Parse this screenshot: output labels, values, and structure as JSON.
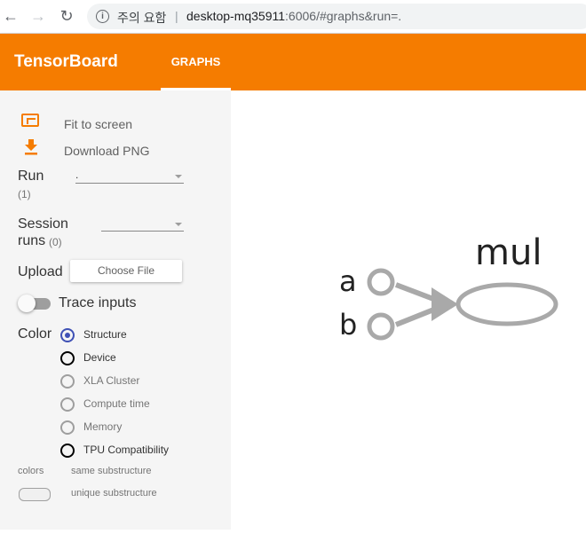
{
  "browser": {
    "back_glyph": "←",
    "forward_glyph": "→",
    "reload_glyph": "↻",
    "info_glyph": "i",
    "security_text": "주의 요함",
    "separator": "|",
    "url_host": "desktop-mq35911",
    "url_rest": ":6006/#graphs&run=."
  },
  "header": {
    "brand": "TensorBoard",
    "tab_graphs": "GRAPHS",
    "color": "#f57c00"
  },
  "sidebar": {
    "fit_to_screen": "Fit to screen",
    "download_png": "Download PNG",
    "run_label": "Run",
    "run_count": "(1)",
    "run_value": ".",
    "session_runs_label_1": "Session",
    "session_runs_label_2": "runs",
    "session_runs_count": "(0)",
    "upload_label": "Upload",
    "choose_file": "Choose File",
    "trace_inputs": "Trace inputs",
    "trace_inputs_on": false,
    "color_label": "Color",
    "color_options": [
      {
        "label": "Structure",
        "selected": true,
        "disabled": false
      },
      {
        "label": "Device",
        "selected": false,
        "disabled": false
      },
      {
        "label": "XLA Cluster",
        "selected": false,
        "disabled": true
      },
      {
        "label": "Compute time",
        "selected": false,
        "disabled": true
      },
      {
        "label": "Memory",
        "selected": false,
        "disabled": true
      },
      {
        "label": "TPU Compatibility",
        "selected": false,
        "disabled": false
      }
    ],
    "colors_heading": "colors",
    "same_substructure": "same substructure",
    "unique_substructure": "unique substructure"
  },
  "graph": {
    "nodes": {
      "a": "a",
      "b": "b",
      "mul": "mul"
    },
    "node_color": "#a9a9a9"
  }
}
